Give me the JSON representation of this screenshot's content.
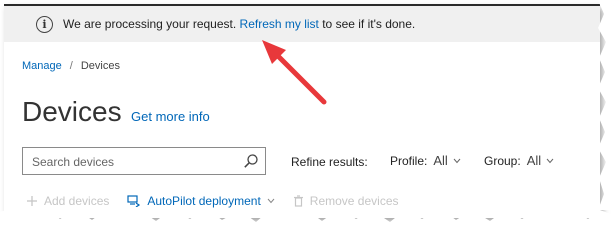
{
  "banner": {
    "icon": "info-icon",
    "message_before": "We are processing your request. ",
    "link_text": "Refresh my list",
    "message_after": " to see if it's done."
  },
  "breadcrumb": {
    "items": [
      "Manage",
      "Devices"
    ],
    "separator": "/"
  },
  "page": {
    "title": "Devices",
    "more_info_link": "Get more info"
  },
  "search": {
    "placeholder": "Search devices"
  },
  "filters": {
    "label": "Refine results:",
    "profile": {
      "label": "Profile:",
      "value": "All"
    },
    "group": {
      "label": "Group:",
      "value": "All"
    }
  },
  "toolbar": {
    "add_devices": "Add devices",
    "autopilot": "AutoPilot deployment",
    "remove_devices": "Remove devices"
  },
  "colors": {
    "link": "#0067b8",
    "annotation_arrow": "#e8383b",
    "banner_bg": "#f0f0f0"
  }
}
